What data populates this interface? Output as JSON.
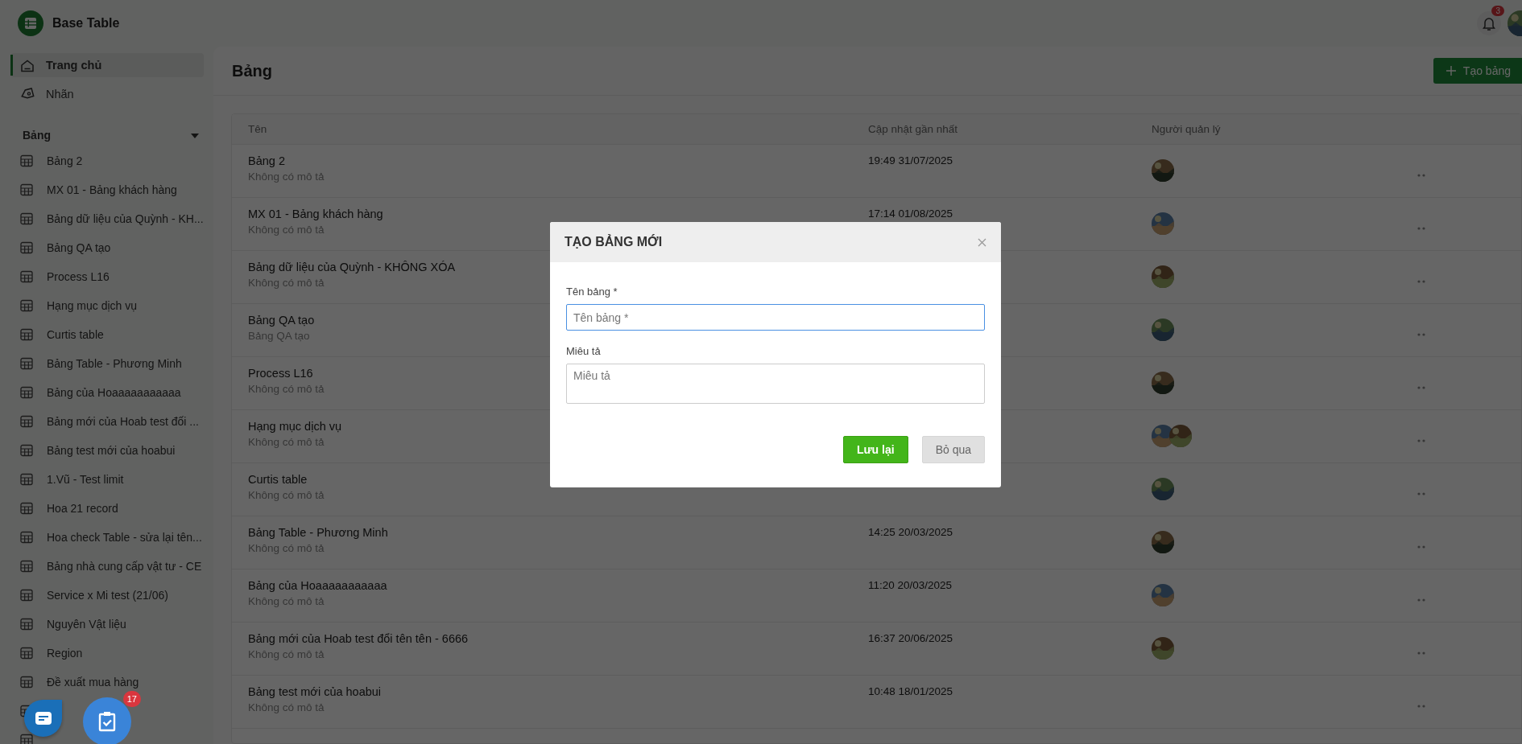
{
  "app": {
    "title": "Base Table",
    "notification_count": "3",
    "show_user_avatar": true
  },
  "sidebar": {
    "nav": [
      {
        "label": "Trang chủ",
        "selected": true
      },
      {
        "label": "Nhãn",
        "selected": false
      }
    ],
    "section": {
      "title": "Bảng",
      "expanded": true
    },
    "tables": [
      {
        "kind": "item",
        "label": "Bảng 2"
      },
      {
        "kind": "item",
        "label": "MX 01 - Bảng khách hàng"
      },
      {
        "kind": "item",
        "label": "Bảng dữ liệu của Quỳnh - KH..."
      },
      {
        "kind": "item",
        "label": "Bảng QA tạo"
      },
      {
        "kind": "item",
        "label": "Process L16"
      },
      {
        "kind": "item",
        "label": "Hạng mục dịch vụ"
      },
      {
        "kind": "item",
        "label": "Curtis table"
      },
      {
        "kind": "item",
        "label": "Bảng Table - Phương Minh"
      },
      {
        "kind": "item",
        "label": "Bảng của Hoaaaaaaaaaaa"
      },
      {
        "kind": "item",
        "label": "Bảng mới của Hoab test đối ..."
      },
      {
        "kind": "item",
        "label": "Bảng test mới của hoabui"
      },
      {
        "kind": "item",
        "label": "1.Vũ - Test limit"
      },
      {
        "kind": "item",
        "label": "Hoa 21 record"
      },
      {
        "kind": "item",
        "label": "Hoa check Table - sửa lại tên..."
      },
      {
        "kind": "item",
        "label": "Bảng nhà cung cấp vật tư - CE"
      },
      {
        "kind": "item",
        "label": "Service x Mi test (21/06)"
      },
      {
        "kind": "item",
        "label": "Nguyên Vật liệu"
      },
      {
        "kind": "item",
        "label": "Region"
      },
      {
        "kind": "item",
        "label": "Đề xuất mua hàng"
      },
      {
        "kind": "covered"
      },
      {
        "kind": "covered"
      }
    ]
  },
  "page": {
    "title": "Bảng",
    "create_button": "Tạo bảng"
  },
  "table": {
    "columns": [
      "Tên",
      "Cập nhật gần nhất",
      "Người quản lý"
    ],
    "rows": [
      {
        "name": "Bảng 2",
        "description": "Không có mô tả",
        "updated": "19:49 31/07/2025"
      },
      {
        "name": "MX 01 - Bảng khách hàng",
        "description": "Không có mô tả",
        "updated": "17:14 01/08/2025"
      },
      {
        "name": "Bảng dữ liệu của Quỳnh - KHÔNG XÓA",
        "description": "Không có mô tả"
      },
      {
        "name": "Bảng QA tạo",
        "description": "Bảng QA tạo"
      },
      {
        "name": "Process L16",
        "description": "Không có mô tả"
      },
      {
        "name": "Hạng mục dịch vụ",
        "description": "Không có mô tả"
      },
      {
        "name": "Curtis table",
        "description": "Không có mô tả"
      },
      {
        "name": "Bảng Table - Phương Minh",
        "description": "Không có mô tả",
        "updated": "14:25 20/03/2025"
      },
      {
        "name": "Bảng của Hoaaaaaaaaaaa",
        "description": "Không có mô tả",
        "updated": "11:20 20/03/2025"
      },
      {
        "name": "Bảng mới của Hoab test đổi tên tên - 6666",
        "description": "Không có mô tả",
        "updated": "16:37 20/06/2025"
      },
      {
        "name": "Bảng test mới của hoabui",
        "description": "Không có mô tả",
        "updated": "10:48 18/01/2025",
        "managers": []
      }
    ]
  },
  "dialog": {
    "title": "TẠO BẢNG MỚI",
    "fields": [
      {
        "kind": "input",
        "label": "Tên bảng *",
        "placeholder": "Tên bảng *",
        "focused": true
      },
      {
        "kind": "textarea",
        "label": "Miêu tả",
        "placeholder": "Miêu tả",
        "focused": false
      }
    ],
    "buttons": [
      {
        "label": "Lưu lại",
        "kind": "primary"
      },
      {
        "label": "Bỏ qua",
        "kind": "secondary"
      }
    ]
  },
  "floating": {
    "task_count": "17"
  }
}
